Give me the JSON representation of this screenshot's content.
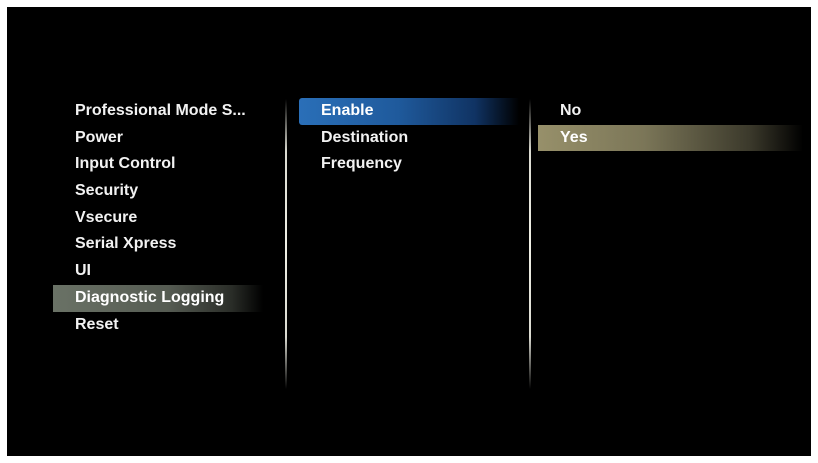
{
  "left_menu": {
    "items": [
      {
        "label": "Professional Mode S..."
      },
      {
        "label": "Power"
      },
      {
        "label": "Input Control"
      },
      {
        "label": "Security"
      },
      {
        "label": "Vsecure"
      },
      {
        "label": "Serial Xpress"
      },
      {
        "label": "UI"
      },
      {
        "label": "Diagnostic Logging"
      },
      {
        "label": "Reset"
      }
    ],
    "selected": "Diagnostic Logging"
  },
  "middle_menu": {
    "items": [
      {
        "label": "Enable"
      },
      {
        "label": "Destination"
      },
      {
        "label": "Frequency"
      }
    ],
    "selected": "Enable"
  },
  "right_menu": {
    "items": [
      {
        "label": "No"
      },
      {
        "label": "Yes"
      }
    ],
    "selected": "Yes"
  },
  "colors": {
    "background": "#000000",
    "text": "#f2f2f2",
    "left_highlight": "#6a7266",
    "middle_highlight": "#2a6fb8",
    "right_highlight": "#97906a"
  }
}
